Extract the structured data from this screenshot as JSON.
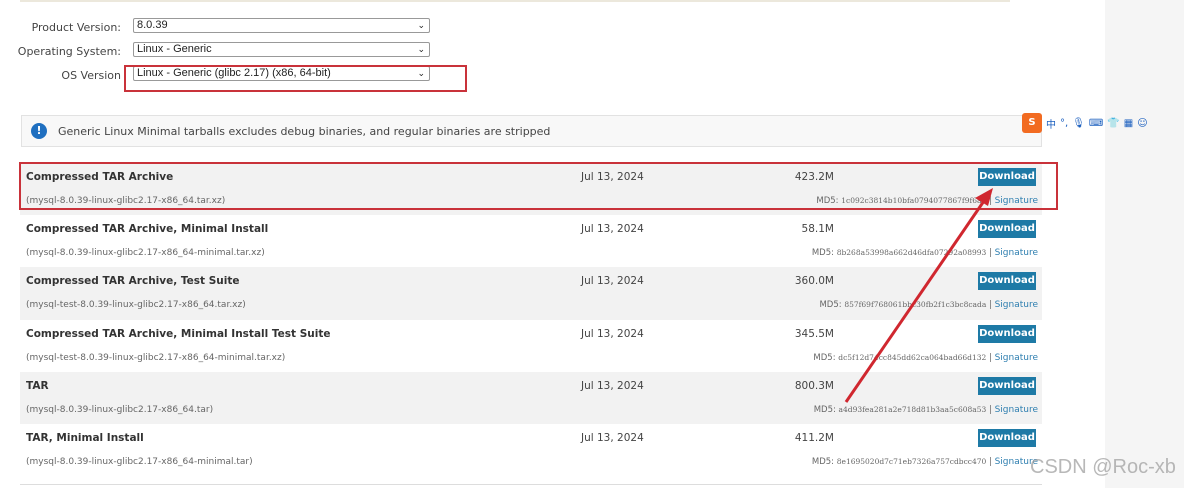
{
  "form": {
    "product_version": {
      "label": "Product Version:",
      "value": "8.0.39"
    },
    "operating_system": {
      "label": "Operating System:",
      "value": "Linux - Generic"
    },
    "os_version": {
      "label": "OS Version",
      "value": "Linux - Generic (glibc 2.17) (x86, 64-bit)"
    }
  },
  "notice": {
    "icon": "info-icon",
    "text": "Generic Linux Minimal tarballs excludes debug binaries, and regular binaries are stripped"
  },
  "downloads": [
    {
      "name": "Compressed TAR Archive",
      "file": "(mysql-8.0.39-linux-glibc2.17-x86_64.tar.xz)",
      "date": "Jul 13, 2024",
      "size": "423.2M",
      "button": "Download",
      "md5_label": "MD5:",
      "md5": "1c092c3814b10bfa0794077867f9f6ad",
      "signature": "Signature"
    },
    {
      "name": "Compressed TAR Archive, Minimal Install",
      "file": "(mysql-8.0.39-linux-glibc2.17-x86_64-minimal.tar.xz)",
      "date": "Jul 13, 2024",
      "size": "58.1M",
      "button": "Download",
      "md5_label": "MD5:",
      "md5": "8b268a53998a662d46dfa07292a08993",
      "signature": "Signature"
    },
    {
      "name": "Compressed TAR Archive, Test Suite",
      "file": "(mysql-test-8.0.39-linux-glibc2.17-x86_64.tar.xz)",
      "date": "Jul 13, 2024",
      "size": "360.0M",
      "button": "Download",
      "md5_label": "MD5:",
      "md5": "857f69f768061bbc30fb2f1c3bc8cada",
      "signature": "Signature"
    },
    {
      "name": "Compressed TAR Archive, Minimal Install Test Suite",
      "file": "(mysql-test-8.0.39-linux-glibc2.17-x86_64-minimal.tar.xz)",
      "date": "Jul 13, 2024",
      "size": "345.5M",
      "button": "Download",
      "md5_label": "MD5:",
      "md5": "dc5f12d74cc845dd62ca064bad66d132",
      "signature": "Signature"
    },
    {
      "name": "TAR",
      "file": "(mysql-8.0.39-linux-glibc2.17-x86_64.tar)",
      "date": "Jul 13, 2024",
      "size": "800.3M",
      "button": "Download",
      "md5_label": "MD5:",
      "md5": "a4d93fea281a2e718d81b3aa5c608a53",
      "signature": "Signature"
    },
    {
      "name": "TAR, Minimal Install",
      "file": "(mysql-8.0.39-linux-glibc2.17-x86_64-minimal.tar)",
      "date": "Jul 13, 2024",
      "size": "411.2M",
      "button": "Download",
      "md5_label": "MD5:",
      "md5": "8e1695020d7c71eb7326a757cdbcc470",
      "signature": "Signature"
    }
  ],
  "ime_toolbar": {
    "logo": "S",
    "lang": "中"
  },
  "watermark": "CSDN @Roc-xb",
  "colors": {
    "button": "#1e7aa6",
    "highlight": "#c9323a",
    "link": "#2f7fb0"
  }
}
